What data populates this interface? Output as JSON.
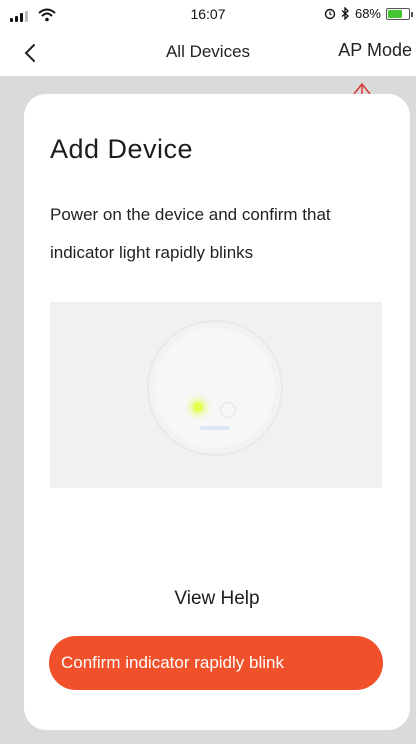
{
  "status_bar": {
    "time": "16:07",
    "battery_text": "68%",
    "battery_level": 0.68,
    "battery_color": "#45c431"
  },
  "nav": {
    "back_icon": "chevron-left-icon",
    "title": "All Devices",
    "right_action": "AP Mode"
  },
  "annotation": {
    "arrow_color": "#d43a3a",
    "icon": "arrow-up-icon"
  },
  "card": {
    "heading": "Add Device",
    "description": "Power on the device and confirm that indicator light rapidly blinks",
    "illustration": "device-blinking-illustration",
    "help_link": "View Help",
    "confirm_button": "Confirm indicator rapidly blink",
    "accent_color": "#f0502a"
  }
}
